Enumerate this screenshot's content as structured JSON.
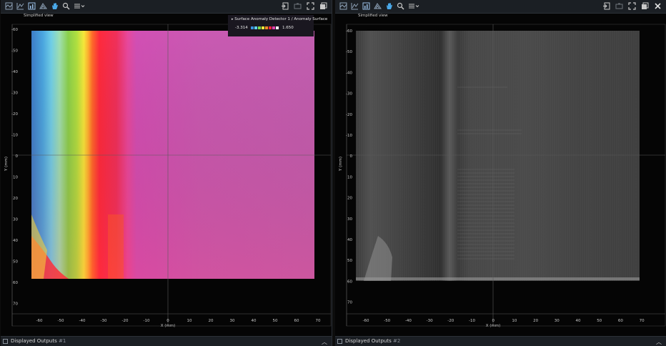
{
  "panels": [
    {
      "view_label": "Simplified view",
      "x_ticks": [
        "-60",
        "-50",
        "-40",
        "-30",
        "-20",
        "-10",
        "0",
        "10",
        "20",
        "30",
        "40",
        "50",
        "60",
        "70"
      ],
      "y_ticks": [
        "-60",
        "-50",
        "-40",
        "-30",
        "-20",
        "-10",
        "0",
        "10",
        "20",
        "30",
        "40",
        "50",
        "60",
        "70"
      ],
      "x_label": "X (mm)",
      "y_label": "Y (mm)",
      "legend": {
        "title": "Surface Anomaly Detector 1 / Anomaly Surface",
        "min": "-3.314",
        "max": "1.650",
        "colors": [
          "#3a8fdc",
          "#5fd0f0",
          "#7dd84a",
          "#f2e83a",
          "#ff8a20",
          "#ff2440",
          "#e040b0",
          "#ffffff"
        ]
      },
      "bottom_label": "Displayed Outputs",
      "bottom_number": "#1",
      "image_type": "color-map-anomaly-surface"
    },
    {
      "view_label": "Simplified view",
      "x_ticks": [
        "-60",
        "-50",
        "-40",
        "-30",
        "-20",
        "-10",
        "0",
        "10",
        "20",
        "30",
        "40",
        "50",
        "60",
        "70"
      ],
      "y_ticks": [
        "-60",
        "-50",
        "-40",
        "-30",
        "-20",
        "-10",
        "0",
        "10",
        "20",
        "30",
        "40",
        "50",
        "60",
        "70"
      ],
      "x_label": "X (mm)",
      "y_label": "Y (mm)",
      "bottom_label": "Displayed Outputs",
      "bottom_number": "#2",
      "image_type": "grayscale-intensity-surface"
    }
  ],
  "toolbar_icons": [
    "view-2d-icon",
    "profile-icon",
    "chart-icon",
    "surface-3d-icon",
    "hand-pan-icon",
    "zoom-icon",
    "menu-icon"
  ],
  "toolbar_right_icons": [
    "export-icon",
    "camera-icon",
    "fullscreen-icon",
    "layout-icon",
    "close-icon"
  ]
}
